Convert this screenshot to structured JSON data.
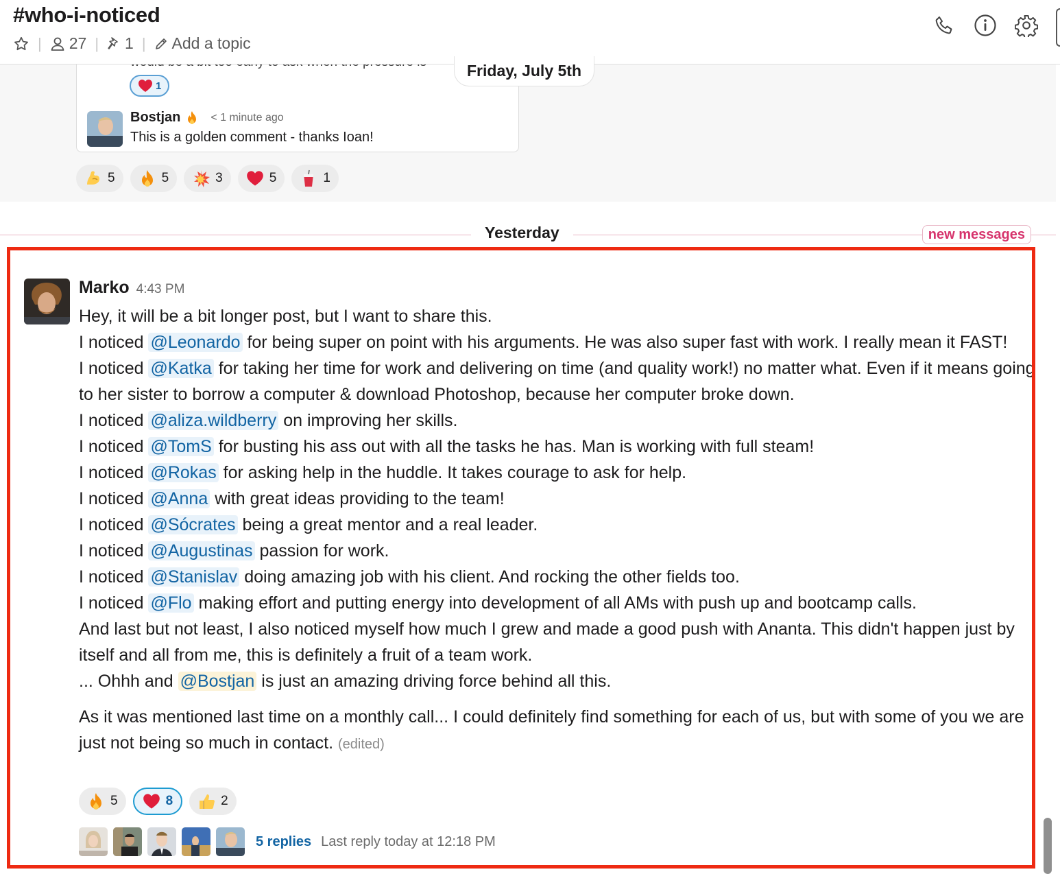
{
  "header": {
    "channel_title": "#who-i-noticed",
    "member_count": "27",
    "pinned_count": "1",
    "add_topic": "Add a topic"
  },
  "previous": {
    "cut_text": "would be a bit too early to ask when the pressure is",
    "mini_reaction_count": "1",
    "reply_author": "Bostjan",
    "reply_time": "< 1 minute ago",
    "reply_text": "This is a golden comment - thanks Ioan!",
    "date_label": "Friday, July 5th",
    "reactions": [
      {
        "icon": "flexed-biceps-emoji",
        "count": "5"
      },
      {
        "icon": "fire-emoji",
        "count": "5"
      },
      {
        "icon": "collision-emoji",
        "count": "3"
      },
      {
        "icon": "heart-emoji",
        "count": "5"
      },
      {
        "icon": "beverage-emoji",
        "count": "1"
      }
    ]
  },
  "divider": {
    "label": "Yesterday",
    "new_messages": "new messages"
  },
  "message": {
    "author": "Marko",
    "time": "4:43 PM",
    "lines": {
      "l1": "Hey, it will be a bit longer post, but I want to share this.",
      "noticed": "I noticed",
      "m_leonardo": "@Leonardo",
      "t_leonardo": "for being super on point with his arguments. He was also super fast with work. I really mean it FAST!",
      "m_katka": "@Katka",
      "t_katka": "for taking her time for work and delivering on time (and quality work!) no matter what. Even if it means going to her sister to borrow a computer & download Photoshop, because her computer broke down.",
      "m_aliza": "@aliza.wildberry",
      "t_aliza": "on improving her skills.",
      "m_toms": "@TomS",
      "t_toms": "for busting his ass out with all the tasks he has. Man is working with full steam!",
      "m_rokas": "@Rokas",
      "t_rokas": "for asking help in the huddle. It takes courage to ask for help.",
      "m_anna": "@Anna",
      "t_anna": "with great ideas providing to the team!",
      "m_socrates": "@Sócrates",
      "t_socrates": "being a great mentor and a real leader.",
      "m_augustinas": "@Augustinas",
      "t_augustinas": "passion for work.",
      "m_stanislav": "@Stanislav",
      "t_stanislav": "doing amazing job with his client. And rocking the other fields too.",
      "m_flo": "@Flo",
      "t_flo": "making effort and putting energy into development of all AMs with push up and bootcamp calls.",
      "last": "And last but not least, I also noticed myself how much I grew and made a good push with Ananta. This didn't happen just by itself and all from me, this is definitely a fruit of a team work.",
      "ohhh_pre": "... Ohhh and",
      "m_bostjan": "@Bostjan",
      "ohhh_post": "is just an amazing driving force behind all this.",
      "para2": "As it was mentioned last time on a monthly call... I could definitely find something for each of us, but with some of you we are just not being so much in contact.",
      "edited": "(edited)"
    },
    "reactions": [
      {
        "icon": "fire-emoji",
        "count": "5"
      },
      {
        "icon": "heart-emoji",
        "count": "8"
      },
      {
        "icon": "thumbs-up-emoji",
        "count": "2"
      }
    ],
    "thread": {
      "replies": "5 replies",
      "last_reply": "Last reply today at 12:18 PM"
    }
  }
}
